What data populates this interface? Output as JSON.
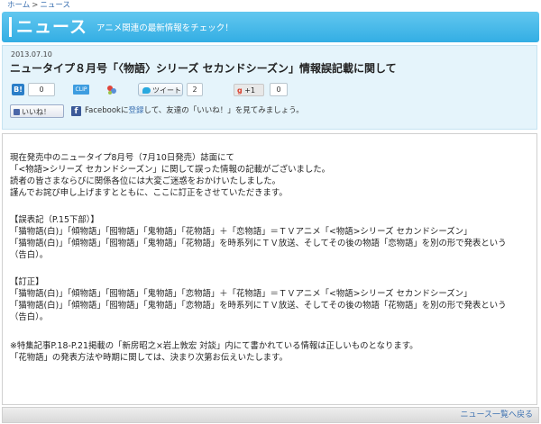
{
  "breadcrumb": {
    "home": "ホーム",
    "separator": ">",
    "current": "ニュース"
  },
  "banner": {
    "title": "ニュース",
    "subtitle": "アニメ関連の最新情報をチェック！"
  },
  "article": {
    "date": "2013.07.10",
    "headline": "ニュータイプ８月号「〈物語〉シリーズ セカンドシーズン」情報誤記載に関して"
  },
  "share": {
    "hatena_icon": "B!",
    "hatena_count": "0",
    "clip_label": "CLIP",
    "tweet_label": "ツイート",
    "tweet_count": "2",
    "gplus_label": "+1",
    "gplus_count": "0"
  },
  "facebook": {
    "like_label": "いいね！",
    "icon": "f",
    "text_before": "Facebookに",
    "register_link": "登録",
    "text_after": "して、友達の「いいね！」を見てみましょう。"
  },
  "body": {
    "lines": [
      "現在発売中のニュータイプ8月号（7月10日発売）誌面にて",
      "「<物語>シリーズ セカンドシーズン」に関して誤った情報の記載がございました。",
      "読者の皆さまならびに関係各位には大変ご迷惑をおかけいたしました。",
      "謹んでお詫び申し上げますとともに、ここに訂正をさせていただきます。",
      "",
      "【誤表記（P.15下部）】",
      "「猫物語(白)」「傾物語」「囮物語」「鬼物語」「花物語」＋「恋物語」＝ＴＶアニメ「<物語>シリーズ セカンドシーズン」",
      "「猫物語(白)」「傾物語」「囮物語」「鬼物語」「花物語」を時系列にＴＶ放送、そしてその後の物語「恋物語」を別の形で発表という",
      "（告白）。",
      "",
      "【訂正】",
      "「猫物語(白)」「傾物語」「囮物語」「鬼物語」「恋物語」＋「花物語」＝ＴＶアニメ「<物語>シリーズ セカンドシーズン」",
      "「猫物語(白)」「傾物語」「囮物語」「鬼物語」「恋物語」を時系列にＴＶ放送、そしてその後の物語「花物語」を別の形で発表という",
      "（告白）。",
      "",
      "※特集記事P.18-P.21掲載の「新房昭之×岩上敦宏 対談」内にて書かれている情報は正しいものとなります。",
      "「花物語」の発表方法や時期に関しては、決まり次第お伝えいたします。"
    ]
  },
  "footer": {
    "back_link": "ニュース一覧へ戻る"
  },
  "colors": {
    "banner": "#33aee4",
    "link": "#3a6fb0",
    "header_bg": "#e5f4fb"
  }
}
